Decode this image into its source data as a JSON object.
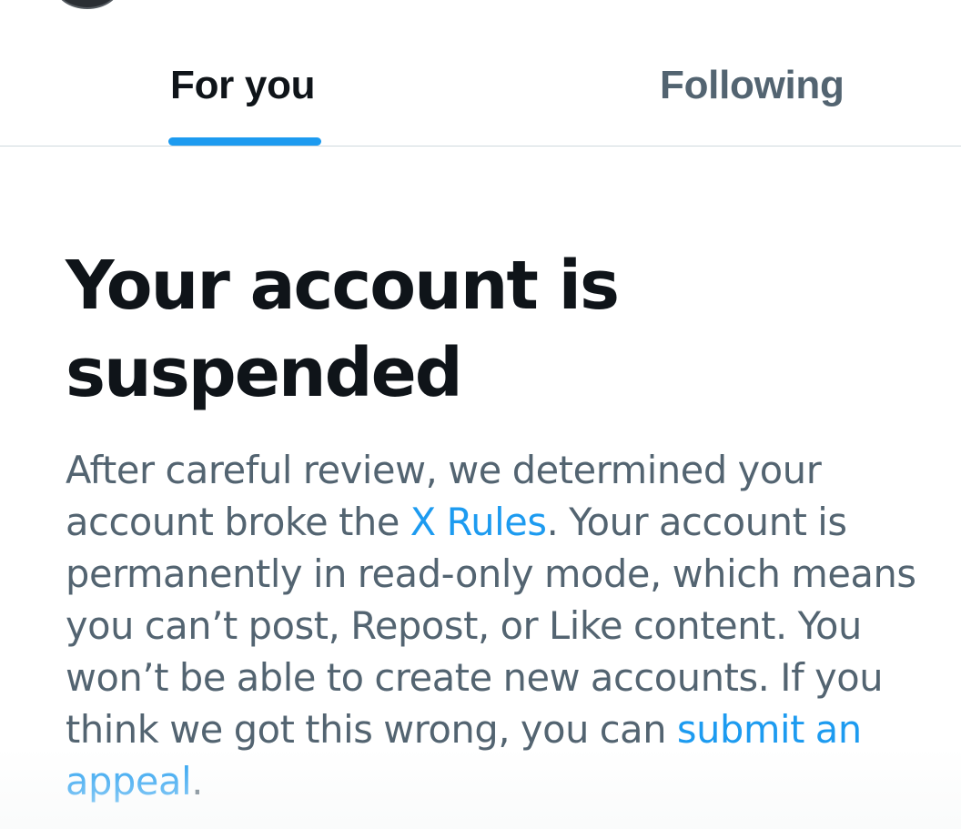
{
  "tabs": {
    "for_you": "For you",
    "following": "Following",
    "active": "For you"
  },
  "notice": {
    "title": "Your account is suspended",
    "text_1": "After careful review, we determined your account broke the ",
    "rules_link": "X Rules",
    "text_2": ". Your account is permanently in read-only mode, which means you can’t post, Repost, or Like content. You won’t be able to create new accounts. If you think we got this wrong, you can ",
    "appeal_link": "submit an appeal",
    "text_3": "."
  },
  "colors": {
    "accent": "#1d9bf0",
    "primary_text": "#0f1419",
    "secondary_text": "#536471",
    "divider": "#cfd9de"
  },
  "icons": {
    "avatar": "avatar"
  }
}
